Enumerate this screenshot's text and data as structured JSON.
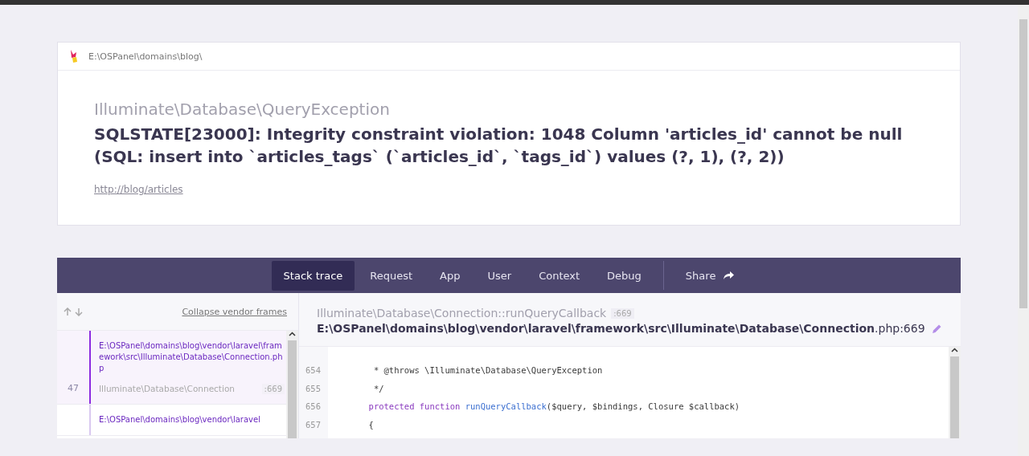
{
  "app_path": "E:\\OSPanel\\domains\\blog\\",
  "exception": {
    "class": "Illuminate\\Database\\QueryException",
    "message": "SQLSTATE[23000]: Integrity constraint violation: 1048 Column 'articles_id' cannot be null (SQL: insert into `articles_tags` (`articles_id`, `tags_id`) values (?, 1), (?, 2))",
    "url": "http://blog/articles"
  },
  "tabs": [
    {
      "label": "Stack trace",
      "selected": true
    },
    {
      "label": "Request",
      "selected": false
    },
    {
      "label": "App",
      "selected": false
    },
    {
      "label": "User",
      "selected": false
    },
    {
      "label": "Context",
      "selected": false
    },
    {
      "label": "Debug",
      "selected": false
    }
  ],
  "share": {
    "label": "Share"
  },
  "frames_toolbar": {
    "collapse_link": "Collapse vendor frames"
  },
  "frames": [
    {
      "number": "47",
      "file": "E:\\OSPanel\\domains\\blog\\vendor\\laravel\\framework\\src\\Illuminate\\Database\\Connection.php",
      "class": "Illuminate\\Database\\Connection",
      "line": ":669",
      "selected": true
    },
    {
      "file": "E:\\OSPanel\\domains\\blog\\vendor\\laravel",
      "selected": false
    }
  ],
  "frame_detail": {
    "method": "Illuminate\\Database\\Connection::runQueryCallback",
    "line": ":669",
    "file_path": "E:\\OSPanel\\domains\\blog\\vendor\\laravel\\framework\\src\\Illuminate\\Database\\Connection",
    "file_suffix": ".php:669"
  },
  "code_lines": [
    {
      "number": "654",
      "segments": [
        {
          "kind": "plain",
          "text": "         * @throws \\Illuminate\\Database\\QueryException"
        }
      ]
    },
    {
      "number": "655",
      "segments": [
        {
          "kind": "plain",
          "text": "         */"
        }
      ]
    },
    {
      "number": "656",
      "segments": [
        {
          "kind": "keyword",
          "text": "        protected function "
        },
        {
          "kind": "function",
          "text": "runQueryCallback"
        },
        {
          "kind": "plain",
          "text": "($query, $bindings, Closure $callback)"
        }
      ]
    },
    {
      "number": "657",
      "segments": [
        {
          "kind": "plain",
          "text": "        {"
        }
      ]
    }
  ]
}
